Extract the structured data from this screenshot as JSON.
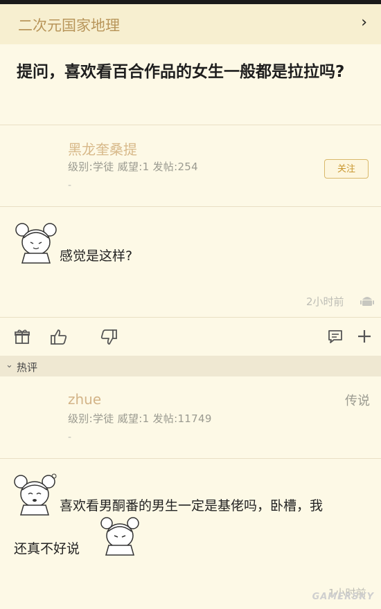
{
  "header": {
    "forum_name": "二次元国家地理"
  },
  "post": {
    "title": "提问，喜欢看百合作品的女生一般都是拉拉吗?",
    "author": {
      "name": "黑龙奎桑提",
      "meta": "级别:学徒 威望:1 发帖:254",
      "dash": "-",
      "follow_label": "关注"
    },
    "content": "感觉是这样?",
    "time": "2小时前"
  },
  "actions": {
    "icons": [
      "gift-icon",
      "thumbs-up-icon",
      "thumbs-down-icon",
      "comment-icon",
      "plus-icon"
    ]
  },
  "hot_section": {
    "label": "热评"
  },
  "reply": {
    "author": {
      "name": "zhue",
      "meta": "级别:学徒 威望:1 发帖:11749",
      "dash": "-",
      "title_badge": "传说"
    },
    "content_line1": "喜欢看男酮番的男生一定是基佬吗，卧槽，我",
    "content_line2": "还真不好说",
    "time": "1小时前"
  },
  "watermark": "GAMERSKY",
  "colors": {
    "background": "#fdf9e6",
    "header": "#f7efd0",
    "accent": "#b8955a",
    "follow": "#c8962e"
  }
}
